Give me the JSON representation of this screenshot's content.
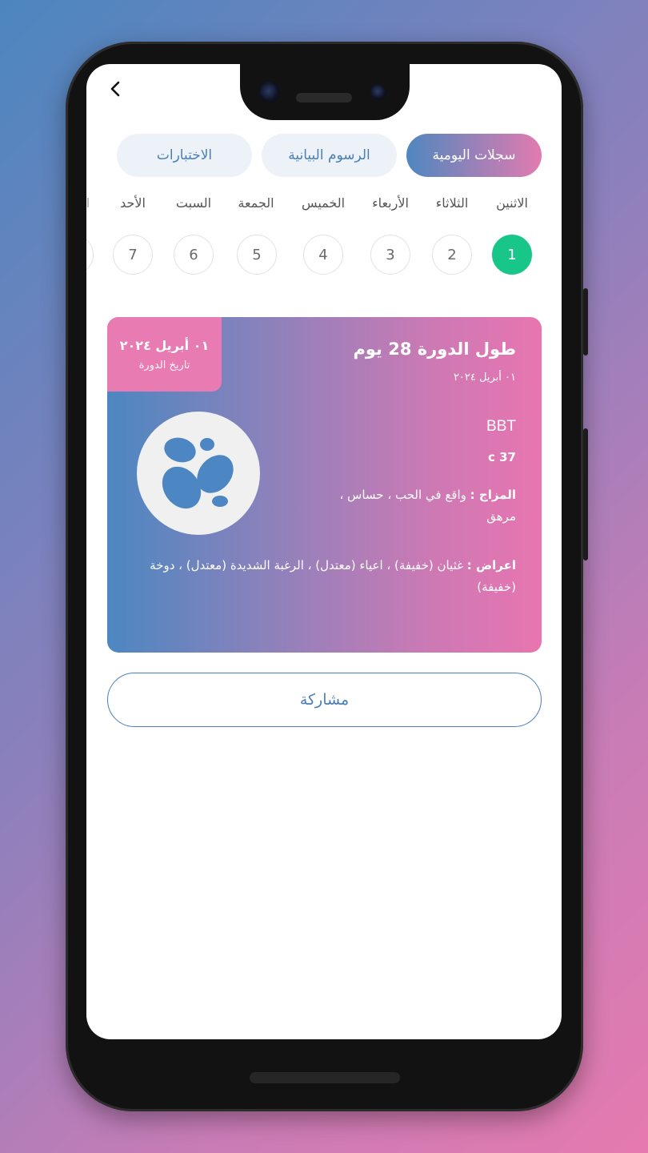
{
  "tabs": [
    {
      "label": "سجلات اليومية",
      "active": true
    },
    {
      "label": "الرسوم البيانية",
      "active": false
    },
    {
      "label": "الاختبارات",
      "active": false
    }
  ],
  "days": [
    "الاثنين",
    "الثلاثاء",
    "الأربعاء",
    "الخميس",
    "الجمعة",
    "السبت",
    "الأحد"
  ],
  "day_numbers": [
    "1",
    "2",
    "3",
    "4",
    "5",
    "6",
    "7"
  ],
  "selected_day": "1",
  "card": {
    "cycle_length": "طول الدورة  28 يوم",
    "cycle_start": "٠١ أبريل ٢٠٢٤",
    "date_badge": "٠١ أبريل ٢٠٢٤",
    "date_badge_label": "تاريخ الدورة",
    "bbt_label": "BBT",
    "bbt_value": "37 c",
    "mood_label": "المزاج :",
    "mood_value": " واقع  في الحب ، حساس ، مرهق",
    "symptoms_label": "اعراض :",
    "symptoms_value": " غثيان (خفيفة) ، اعياء (معتدل) ، الرغبة الشديدة (معتدل) ، دوخة (خفيفة)"
  },
  "share_label": "مشاركة",
  "colors": {
    "accent_blue": "#4a7fb8",
    "accent_pink": "#e27bb0",
    "selected_day": "#19c68a"
  },
  "icons": {
    "back": "chevron-left-icon",
    "logo": "paw-blobs-logo-icon"
  }
}
